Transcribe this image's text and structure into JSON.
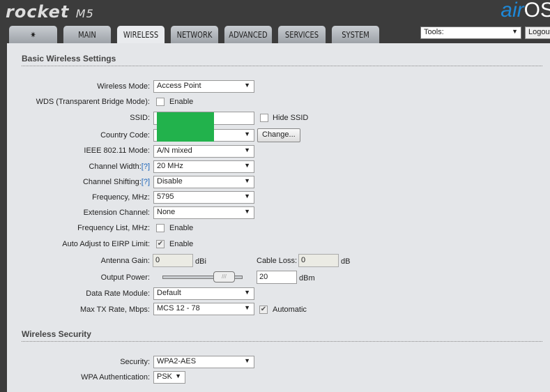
{
  "header": {
    "product": "rocket",
    "model": "M5",
    "brand_a": "air",
    "brand_b": "OS"
  },
  "tabs": [
    {
      "label": "logo"
    },
    {
      "label": "MAIN"
    },
    {
      "label": "WIRELESS"
    },
    {
      "label": "NETWORK"
    },
    {
      "label": "ADVANCED"
    },
    {
      "label": "SERVICES"
    },
    {
      "label": "SYSTEM"
    }
  ],
  "tools": {
    "value": "Tools:",
    "logout": "Logout"
  },
  "basic": {
    "title": "Basic Wireless Settings",
    "wireless_mode": {
      "label": "Wireless Mode:",
      "value": "Access Point"
    },
    "wds": {
      "label": "WDS (Transparent Bridge Mode):",
      "option": "Enable",
      "checked": false
    },
    "ssid": {
      "label": "SSID:",
      "value": "",
      "hide": "Hide SSID"
    },
    "country": {
      "label": "Country Code:",
      "value": "",
      "button": "Change..."
    },
    "ieee": {
      "label": "IEEE 802.11 Mode:",
      "value": "A/N mixed"
    },
    "width": {
      "label": "Channel Width:",
      "help": "[?]",
      "value": "20 MHz"
    },
    "shift": {
      "label": "Channel Shifting:",
      "help": "[?]",
      "value": "Disable"
    },
    "freq": {
      "label": "Frequency, MHz:",
      "value": "5795"
    },
    "ext": {
      "label": "Extension Channel:",
      "value": "None"
    },
    "freqlist": {
      "label": "Frequency List, MHz:",
      "option": "Enable"
    },
    "eirp": {
      "label": "Auto Adjust to EIRP Limit:",
      "option": "Enable"
    },
    "gain": {
      "label": "Antenna Gain:",
      "value": "0",
      "unit": "dBi"
    },
    "loss": {
      "label": "Cable Loss:",
      "value": "0",
      "unit": "dB"
    },
    "power": {
      "label": "Output Power:",
      "value": "20",
      "unit": "dBm",
      "slider_fraction": 0.85
    },
    "rate_module": {
      "label": "Data Rate Module:",
      "value": "Default"
    },
    "maxrate": {
      "label": "Max TX Rate, Mbps:",
      "value": "MCS 12 - 78",
      "auto": "Automatic"
    }
  },
  "security": {
    "title": "Wireless Security",
    "security": {
      "label": "Security:",
      "value": "WPA2-AES"
    },
    "auth": {
      "label": "WPA Authentication:",
      "value": "PSK"
    }
  },
  "colors": {
    "redaction": "#22b24c",
    "link": "#1a63b8"
  }
}
